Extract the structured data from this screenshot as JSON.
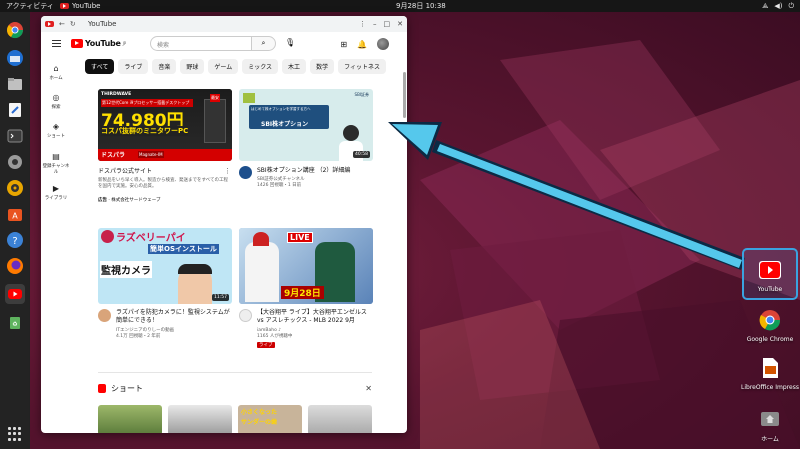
{
  "topbar": {
    "activities": "アクティビティ",
    "app_name": "YouTube",
    "clock": "9月28日  10:38",
    "tray_icons": [
      "network-icon",
      "volume-icon",
      "power-icon"
    ]
  },
  "dock": {
    "items": [
      "chrome",
      "thunderbird",
      "files",
      "text-editor",
      "terminal",
      "settings",
      "rhythmbox",
      "app-center",
      "help",
      "firefox",
      "youtube",
      "trash"
    ],
    "show_apps_icon": "grid-icon"
  },
  "browser": {
    "tab_title": "YouTube",
    "colors": {
      "yt_red": "#ff0000",
      "chip_active_bg": "#0f0f0f"
    }
  },
  "youtube": {
    "logo_text": "YouTube",
    "logo_sup": "JP",
    "search_placeholder": "検索",
    "chips": [
      "すべて",
      "ライブ",
      "音楽",
      "野球",
      "ゲーム",
      "ミックス",
      "木工",
      "数学",
      "フィットネス"
    ],
    "sidebar": [
      {
        "icon": "home-icon",
        "label": "ホーム"
      },
      {
        "icon": "explore-icon",
        "label": "探索"
      },
      {
        "icon": "shorts-icon",
        "label": "ショート"
      },
      {
        "icon": "subscriptions-icon",
        "label": "登録チャンネル"
      },
      {
        "icon": "library-icon",
        "label": "ライブラリ"
      }
    ],
    "videos": [
      {
        "thumb_brand": "THIRDWAVE",
        "thumb_text1": "第12世代Core i9プロセッサー搭載デスクトップ",
        "thumb_price": "74,980円",
        "thumb_text2": "コスパ抜群のミニタワーPC",
        "thumb_footer": "ドスパラ",
        "thumb_tag": "Magnate-IM",
        "thumb_badge": "最安",
        "title": "ドスパラ公式サイト",
        "desc": "新製品をいち早く導入。製造から検査、発送までをすべての工程を国内で実施。安心の品質。",
        "ad_label": "広告",
        "ad_channel": "株式会社サードウェーブ"
      },
      {
        "thumb_logo": "SBI証券",
        "thumb_text": "SBI株オプション",
        "thumb_sub": "はじめて株オプションを学習する方へ",
        "duration": "40:58",
        "title": "SBI株オプション講座 （2）詳細編",
        "channel": "SBI証券公式チャンネル",
        "meta": "1426 回視聴・1 日前"
      },
      {
        "thumb_text1": "ラズベリーパイ",
        "thumb_text2": "簡単OSインストール",
        "thumb_text3": "監視カメラ",
        "duration": "11:57",
        "title": "ラズパイを防犯カメラに！監視システムが簡単にできる！",
        "channel": "ITエンジニアのりしーの動画",
        "meta": "4.1万 回視聴・2 年前"
      },
      {
        "thumb_live": "LIVE",
        "thumb_date": "9月28日",
        "title": "【大谷翔平 ライブ】大谷翔平エンゼルス vs アスレチックス - MLB 2022 9月",
        "channel": "iamBaho ♪",
        "meta": "1165 人が視聴中",
        "live_label": "ライブ"
      }
    ],
    "shorts_label": "ショート",
    "shorts_thumb_text": [
      "小さくなった",
      "サンダーの歯"
    ]
  },
  "desktop": {
    "icons": [
      {
        "label": "YouTube",
        "icon": "youtube-icon",
        "selected": true
      },
      {
        "label": "Google Chrome",
        "icon": "chrome-icon"
      },
      {
        "label": "LibreOffice Impress",
        "icon": "impress-icon"
      },
      {
        "label": "ホーム",
        "icon": "home-folder-icon"
      }
    ]
  }
}
